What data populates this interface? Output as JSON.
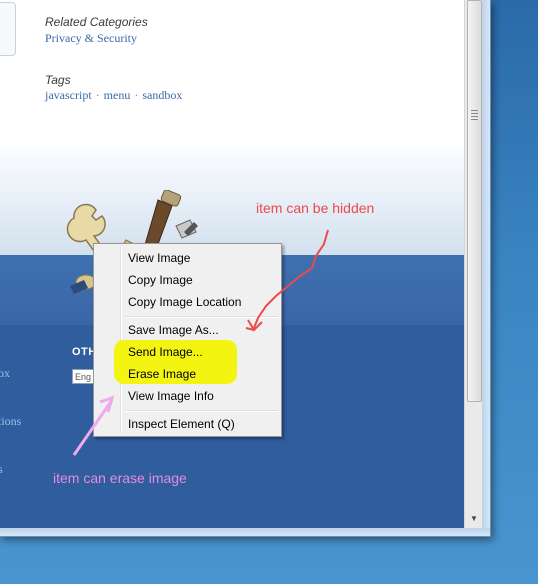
{
  "page": {
    "related_heading": "Related Categories",
    "related_link": "Privacy & Security",
    "tags_heading": "Tags",
    "tags": [
      "javascript",
      "menu",
      "sandbox"
    ],
    "tag_separator": "·",
    "footer_links": [
      "ox",
      "tions",
      "s"
    ],
    "other_heading": "OTH",
    "language_value": "Eng"
  },
  "context_menu": {
    "items": [
      {
        "label": "View Image"
      },
      {
        "label": "Copy Image"
      },
      {
        "label": "Copy Image Location"
      },
      {
        "label": "Save Image As..."
      },
      {
        "label": "Send Image..."
      },
      {
        "label": "Erase Image"
      },
      {
        "label": "View Image Info"
      },
      {
        "label": "Inspect Element (Q)"
      }
    ]
  },
  "annotations": {
    "hidden_note": "item can be hidden",
    "erase_note": "item can erase image",
    "hidden_color": "#ea4a4a",
    "erase_color": "#e58be0",
    "highlight_color": "#f4f400"
  },
  "colors": {
    "link": "#3a6aa6",
    "band": "#3a66a6",
    "desktop": "#3a84c2"
  },
  "icons": [
    "tools-icon",
    "scroll-grip-icon",
    "scroll-down-arrow-icon",
    "menu-separator-icon"
  ]
}
